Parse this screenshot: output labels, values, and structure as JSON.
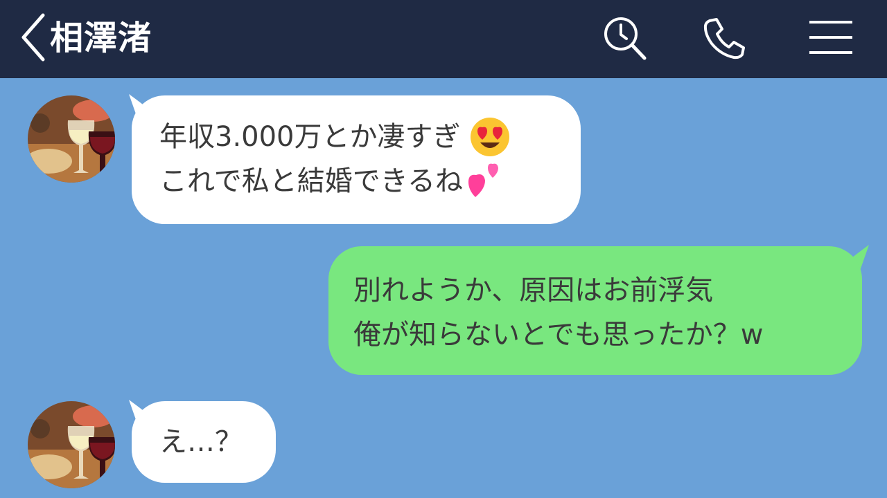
{
  "header": {
    "title": "相澤渚",
    "icons": [
      "back-icon",
      "search-icon",
      "phone-icon",
      "menu-icon"
    ]
  },
  "messages": [
    {
      "side": "incoming",
      "lines": [
        "年収3.000万とか凄すぎ",
        "これで私と結婚できるね"
      ],
      "emojis": [
        "heart-eyes-emoji",
        "two-hearts-emoji"
      ]
    },
    {
      "side": "outgoing",
      "lines": [
        "別れようか、原因はお前浮気",
        "俺が知らないとでも思ったか？w"
      ]
    },
    {
      "side": "incoming",
      "lines": [
        "え…？"
      ]
    }
  ],
  "colors": {
    "header_bg": "#1f2a44",
    "chat_bg": "#6aa1d8",
    "incoming_bubble": "#ffffff",
    "outgoing_bubble": "#79e77f",
    "text": "#3a3a3a"
  }
}
